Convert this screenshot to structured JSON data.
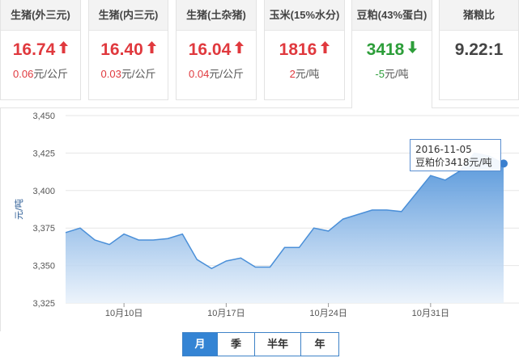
{
  "colors": {
    "up": "#e0393e",
    "down": "#2d9e3a",
    "line": "#4a8fd8",
    "area_top": "#4a8fd8",
    "area_bottom": "#eaf2fb",
    "grid": "#e6e6e6",
    "tab_selected": "#3484d4"
  },
  "cards": [
    {
      "title": "生猪(外三元)",
      "price": "16.74",
      "trend": "up",
      "change": "0.06",
      "unit": "元/公斤",
      "arrow_icon": "arrow-up-icon"
    },
    {
      "title": "生猪(内三元)",
      "price": "16.40",
      "trend": "up",
      "change": "0.03",
      "unit": "元/公斤",
      "arrow_icon": "arrow-up-icon"
    },
    {
      "title": "生猪(土杂猪)",
      "price": "16.04",
      "trend": "up",
      "change": "0.04",
      "unit": "元/公斤",
      "arrow_icon": "arrow-up-icon"
    },
    {
      "title": "玉米(15%水分)",
      "price": "1816",
      "trend": "up",
      "change": "2",
      "unit": "元/吨",
      "arrow_icon": "arrow-up-icon"
    },
    {
      "title": "豆粕(43%蛋白)",
      "price": "3418",
      "trend": "down",
      "change": "-5",
      "unit": "元/吨",
      "arrow_icon": "arrow-down-icon"
    },
    {
      "title": "猪粮比",
      "price": "9.22:1",
      "trend": "neutral",
      "change": "",
      "unit": ""
    }
  ],
  "tooltip": {
    "date": "2016-11-05",
    "text": "豆粕价3418元/吨"
  },
  "range_tabs": [
    {
      "label": "月",
      "selected": true
    },
    {
      "label": "季",
      "selected": false
    },
    {
      "label": "半年",
      "selected": false
    },
    {
      "label": "年",
      "selected": false
    }
  ],
  "chart_data": {
    "type": "area",
    "title": "",
    "xlabel": "",
    "ylabel": "元/吨",
    "ylim": [
      3325,
      3450
    ],
    "yticks": [
      3325,
      3350,
      3375,
      3400,
      3425,
      3450
    ],
    "ytick_labels": [
      "3,325",
      "3,350",
      "3,375",
      "3,400",
      "3,425",
      "3,450"
    ],
    "xtick_labels": [
      {
        "label": "10月10日",
        "x": "2016-10-10"
      },
      {
        "label": "10月17日",
        "x": "2016-10-17"
      },
      {
        "label": "10月24日",
        "x": "2016-10-24"
      },
      {
        "label": "10月31日",
        "x": "2016-10-31"
      }
    ],
    "grid": true,
    "series": [
      {
        "name": "豆粕价",
        "x": [
          "2016-10-06",
          "2016-10-07",
          "2016-10-08",
          "2016-10-09",
          "2016-10-10",
          "2016-10-11",
          "2016-10-12",
          "2016-10-13",
          "2016-10-14",
          "2016-10-15",
          "2016-10-16",
          "2016-10-17",
          "2016-10-18",
          "2016-10-19",
          "2016-10-20",
          "2016-10-21",
          "2016-10-22",
          "2016-10-23",
          "2016-10-24",
          "2016-10-25",
          "2016-10-26",
          "2016-10-27",
          "2016-10-28",
          "2016-10-29",
          "2016-10-30",
          "2016-10-31",
          "2016-11-01",
          "2016-11-02",
          "2016-11-03",
          "2016-11-04",
          "2016-11-05"
        ],
        "values": [
          3372,
          3375,
          3367,
          3364,
          3371,
          3367,
          3367,
          3368,
          3371,
          3354,
          3348,
          3353,
          3355,
          3349,
          3349,
          3362,
          3362,
          3375,
          3373,
          3381,
          3384,
          3387,
          3387,
          3386,
          3398,
          3410,
          3407,
          3413,
          3425,
          3423,
          3418
        ]
      }
    ]
  }
}
